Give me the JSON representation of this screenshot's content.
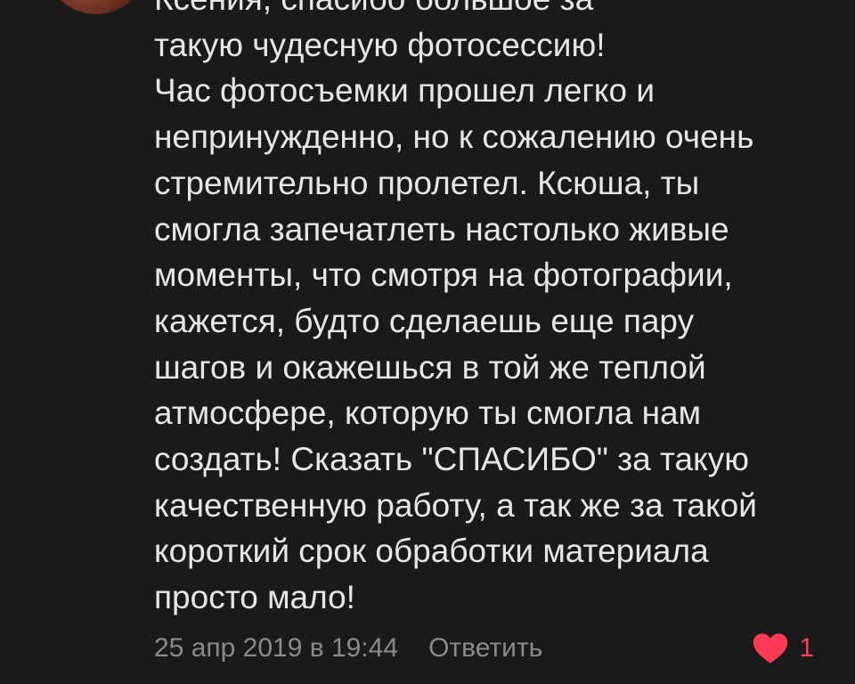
{
  "comment": {
    "text": "Ксения, спасибо большое за\nтакую чудесную фотосессию!\nЧас фотосъемки прошел легко и\nнепринужденно, но к сожалению очень\nстремительно пролетел. Ксюша, ты\nсмогла запечатлеть настолько живые\nмоменты, что смотря на фотографии,\nкажется, будто сделаешь еще пару\nшагов и окажешься в той же теплой\nатмосфере, которую ты смогла нам\nсоздать! Сказать \"СПАСИБО\" за такую\nкачественную работу, а так же за такой\nкороткий срок обработки материала\nпросто мало!"
  },
  "meta": {
    "date": "25 апр 2019 в 19:44",
    "reply_label": "Ответить"
  },
  "likes": {
    "count": "1",
    "icon": "heart-icon",
    "color": "#ff3a55"
  },
  "colors": {
    "background": "#1a1a1a",
    "text": "#e6e6e6",
    "muted": "#8a8a8a",
    "accent": "#ff3a55"
  }
}
